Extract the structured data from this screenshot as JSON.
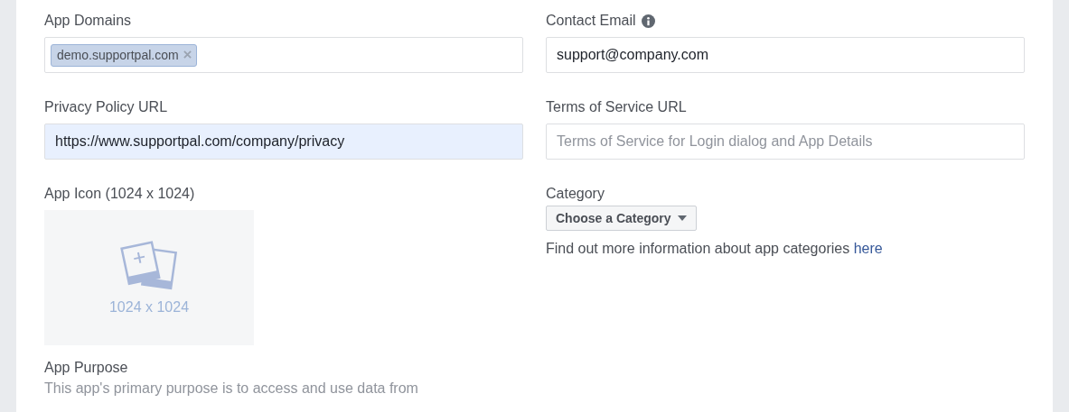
{
  "fields": [
    {
      "kind": "tags",
      "label": "App Domains",
      "tags": [
        "demo.supportpal.com"
      ]
    },
    {
      "kind": "text",
      "label": "Contact Email",
      "info": true,
      "value": "support@company.com",
      "autofilled": false
    },
    {
      "kind": "text",
      "label": "Privacy Policy URL",
      "value": "https://www.supportpal.com/company/privacy",
      "autofilled": true
    },
    {
      "kind": "text",
      "label": "Terms of Service URL",
      "placeholder": "Terms of Service for Login dialog and App Details",
      "autofilled": false
    },
    {
      "kind": "image",
      "label": "App Icon (1024 x 1024)",
      "hint": "1024 x 1024"
    },
    {
      "kind": "select",
      "label": "Category",
      "button": "Choose a Category",
      "help": "Find out more information about app categories",
      "link": "here"
    }
  ],
  "purpose": {
    "label": "App Purpose",
    "text": "This app's primary purpose is to access and use data from"
  }
}
